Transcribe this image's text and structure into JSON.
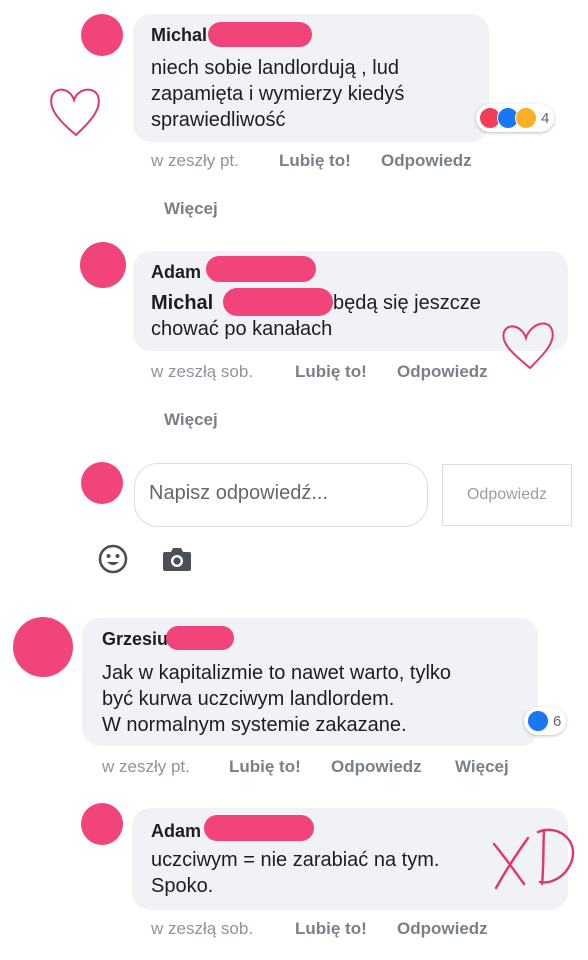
{
  "comments": [
    {
      "name": "Michal",
      "lines": [
        "niech sobie landlordują , lud",
        "zapamięta i wymierzy kiedyś",
        "sprawiedliwość"
      ],
      "reaction_count": "4",
      "time": "w zeszły pt.",
      "like": "Lubię to!",
      "reply": "Odpowiedz",
      "more": "Więcej"
    },
    {
      "name": "Adam",
      "mention": "Michal",
      "line1_rest": "będą się jeszcze",
      "line2": "chować po kanałach",
      "time": "w zeszłą sob.",
      "like": "Lubię to!",
      "reply": "Odpowiedz",
      "more": "Więcej"
    },
    {
      "name": "Grzesiu",
      "lines": [
        "Jak w kapitalizmie to nawet warto, tylko",
        "być kurwa uczciwym landlordem.",
        "W normalnym systemie zakazane."
      ],
      "reaction_count": "6",
      "time": "w zeszły pt.",
      "like": "Lubię to!",
      "reply": "Odpowiedz",
      "more": "Więcej"
    },
    {
      "name": "Adam",
      "lines": [
        "uczciwym = nie zarabiać na tym.",
        "Spoko."
      ],
      "time": "w zeszłą sob.",
      "like": "Lubię to!",
      "reply": "Odpowiedz"
    }
  ],
  "reply_box": {
    "placeholder": "Napisz odpowiedź...",
    "send_label": "Odpowiedz"
  },
  "annotation_text": "XD",
  "colors": {
    "redaction": "#f0447a",
    "bubble": "#f0f2f5",
    "like_blue": "#1877f2",
    "love_red": "#f33e58",
    "haha_yellow": "#f7b125"
  }
}
